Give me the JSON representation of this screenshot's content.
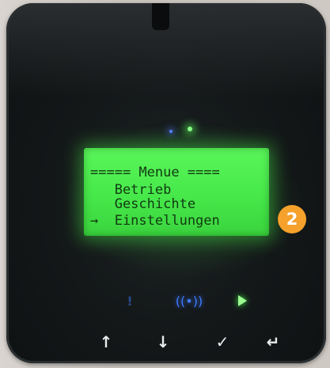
{
  "display": {
    "lines": [
      "===== Menue ====",
      "   Betrieb",
      "   Geschichte",
      "→  Einstellungen"
    ]
  },
  "badge": {
    "label": "2",
    "color": "#f5a12b"
  },
  "indicators": [
    {
      "icon": "alert-icon",
      "glyph": "!"
    },
    {
      "icon": "wifi-icon",
      "glyph": "((•))"
    },
    {
      "icon": "play-icon"
    }
  ],
  "buttons": [
    {
      "icon": "arrow-up-icon",
      "glyph": "↑"
    },
    {
      "icon": "arrow-down-icon",
      "glyph": "↓"
    },
    {
      "icon": "check-icon",
      "glyph": "✓"
    },
    {
      "icon": "return-icon",
      "glyph": "↵"
    }
  ],
  "colors": {
    "lcd": "#4ee84f",
    "device": "#141819",
    "accent_blue": "#3d7bff"
  }
}
